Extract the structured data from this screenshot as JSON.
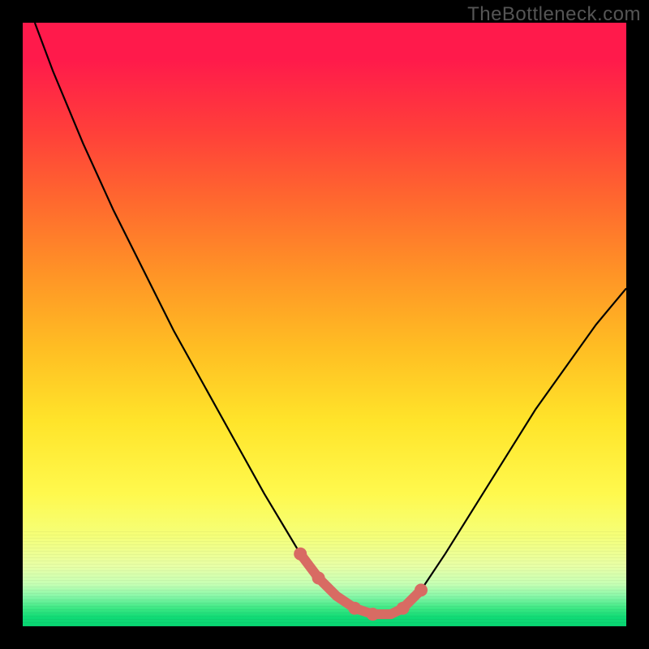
{
  "watermark": {
    "text": "TheBottleneck.com"
  },
  "colors": {
    "background": "#000000",
    "gradient_top": "#ff1a4b",
    "gradient_mid": "#ffbe23",
    "gradient_bottom": "#07d571",
    "curve_stroke": "#000000",
    "highlight_stroke": "#d86b63"
  },
  "chart_data": {
    "type": "line",
    "title": "",
    "xlabel": "",
    "ylabel": "",
    "xlim": [
      0,
      100
    ],
    "ylim": [
      0,
      100
    ],
    "series": [
      {
        "name": "bottleneck-curve",
        "x": [
          2,
          5,
          10,
          15,
          20,
          25,
          30,
          35,
          40,
          43,
          46,
          49,
          52,
          55,
          58,
          61,
          63,
          66,
          70,
          75,
          80,
          85,
          90,
          95,
          100
        ],
        "y": [
          100,
          92,
          80,
          69,
          59,
          49,
          40,
          31,
          22,
          17,
          12,
          8,
          5,
          3,
          2,
          2,
          3,
          6,
          12,
          20,
          28,
          36,
          43,
          50,
          56
        ]
      },
      {
        "name": "highlight-segment",
        "x": [
          46,
          49,
          52,
          55,
          58,
          61,
          63,
          66
        ],
        "y": [
          12,
          8,
          5,
          3,
          2,
          2,
          3,
          6
        ]
      }
    ],
    "highlight_dots": {
      "x": [
        46,
        49,
        55,
        58,
        63,
        66
      ],
      "y": [
        12,
        8,
        3,
        2,
        3,
        6
      ]
    }
  }
}
